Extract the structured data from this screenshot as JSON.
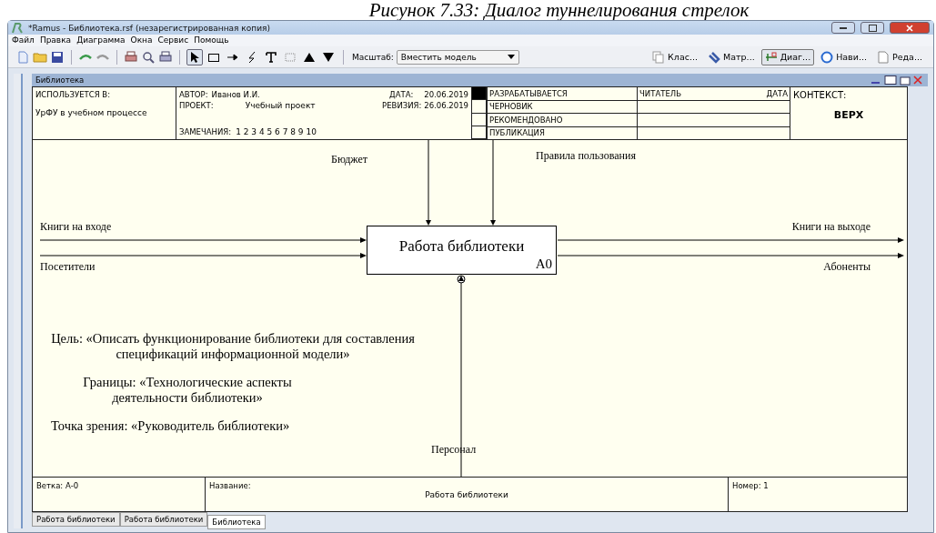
{
  "caption": "Рисунок 7.33: Диалог туннелирования стрелок",
  "window": {
    "title": "*Ramus - Библиотека.rsf (незарегистрированная копия)"
  },
  "menu": [
    "Файл",
    "Правка",
    "Диаграмма",
    "Окна",
    "Сервис",
    "Помощь"
  ],
  "toolbar": {
    "tools": [
      {
        "kind": "pointer",
        "selected": true
      },
      {
        "kind": "box",
        "selected": false
      },
      {
        "kind": "arrow",
        "selected": false
      },
      {
        "kind": "squiggle",
        "selected": false
      },
      {
        "kind": "text",
        "selected": false
      },
      {
        "kind": "dots",
        "selected": false
      },
      {
        "kind": "up",
        "selected": false
      },
      {
        "kind": "down",
        "selected": false
      }
    ],
    "zoom_label": "Масштаб:",
    "zoom_value": "Вместить модель",
    "views": [
      {
        "label": "Клас...",
        "selected": false
      },
      {
        "label": "Матр...",
        "selected": false
      },
      {
        "label": "Диаг...",
        "selected": true
      },
      {
        "label": "Нави...",
        "selected": false
      },
      {
        "label": "Реда...",
        "selected": false
      }
    ]
  },
  "document": {
    "title": "Библиотека",
    "header": {
      "used_in_label": "ИСПОЛЬЗУЕТСЯ В:",
      "used_in": "УрФУ в учебном процессе",
      "author_label": "АВТОР:",
      "author": "Иванов И.И.",
      "date_label": "ДАТА:",
      "date": "20.06.2019",
      "project_label": "ПРОЕКТ:",
      "project": "Учебный проект",
      "revision_label": "РЕВИЗИЯ:",
      "revision": "26.06.2019",
      "notes_label": "ЗАМЕЧАНИЯ:",
      "notes": "1 2 3 4 5 6 7 8 9 10",
      "statuses": [
        {
          "label": "РАЗРАБАТЫВАЕТСЯ",
          "selected": true
        },
        {
          "label": "ЧЕРНОВИК",
          "selected": false
        },
        {
          "label": "РЕКОМЕНДОВАНО",
          "selected": false
        },
        {
          "label": "ПУБЛИКАЦИЯ",
          "selected": false
        }
      ],
      "reader_label": "ЧИТАТЕЛЬ",
      "reader_date_label": "ДАТА",
      "context_label": "КОНТЕКСТ:",
      "context": "ВЕРХ"
    },
    "diagram": {
      "box": {
        "title": "Работа библиотеки",
        "number": "A0"
      },
      "arrows": [
        {
          "kind": "control",
          "label": "Бюджет"
        },
        {
          "kind": "control",
          "label": "Правила пользования"
        },
        {
          "kind": "input",
          "label": "Книги на входе"
        },
        {
          "kind": "input",
          "label": "Посетители"
        },
        {
          "kind": "output",
          "label": "Книги на выходе"
        },
        {
          "kind": "output",
          "label": "Абоненты"
        },
        {
          "kind": "mechanism",
          "label": "Персонал"
        }
      ],
      "notes": [
        "Цель: «Описать функционирование библиотеки для составления спецификаций информационной модели»",
        "Границы: «Технологические аспекты деятельности библиотеки»",
        "Точка зрения: «Руководитель библиотеки»"
      ]
    },
    "footer": {
      "node": "Ветка: А-0",
      "name_label": "Название:",
      "name": "Работа библиотеки",
      "number": "Номер: 1"
    },
    "tabs": [
      {
        "label": "Работа библиотеки",
        "selected": false
      },
      {
        "label": "Работа библиотеки",
        "selected": false
      },
      {
        "label": "Библиотека",
        "selected": true
      }
    ]
  }
}
